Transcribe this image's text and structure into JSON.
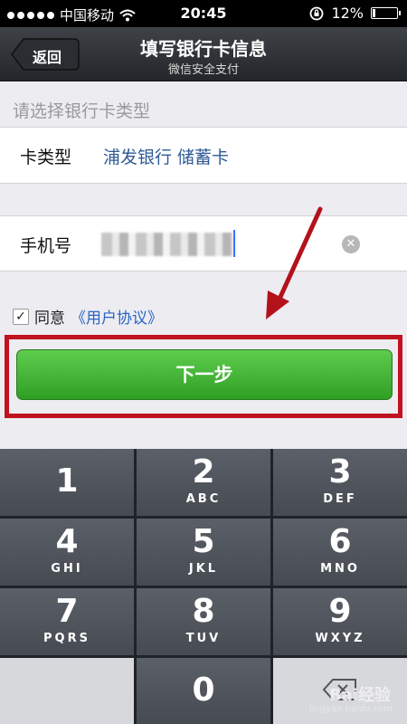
{
  "status": {
    "carrier": "中国移动",
    "time": "20:45",
    "battery_percent": "12%",
    "battery_level": 0.12
  },
  "nav": {
    "back_label": "返回",
    "title": "填写银行卡信息",
    "subtitle": "微信安全支付"
  },
  "form": {
    "section_header": "请选择银行卡类型",
    "card_type_label": "卡类型",
    "card_type_value": "浦发银行 储蓄卡",
    "phone_label": "手机号"
  },
  "agreement": {
    "agree_label": "同意",
    "link_label": "《用户协议》",
    "checked": true
  },
  "actions": {
    "next_label": "下一步"
  },
  "keypad": {
    "keys": [
      {
        "digit": "1",
        "letters": ""
      },
      {
        "digit": "2",
        "letters": "ABC"
      },
      {
        "digit": "3",
        "letters": "DEF"
      },
      {
        "digit": "4",
        "letters": "GHI"
      },
      {
        "digit": "5",
        "letters": "JKL"
      },
      {
        "digit": "6",
        "letters": "MNO"
      },
      {
        "digit": "7",
        "letters": "PQRS"
      },
      {
        "digit": "8",
        "letters": "TUV"
      },
      {
        "digit": "9",
        "letters": "WXYZ"
      },
      {
        "digit": "0",
        "letters": ""
      }
    ]
  },
  "watermark": {
    "brand": "Bai经验",
    "url": "jingyan.baidu.com"
  },
  "colors": {
    "accent_green": "#2f9f24",
    "highlight_red": "#c1121f",
    "link_blue": "#2a64c5"
  }
}
